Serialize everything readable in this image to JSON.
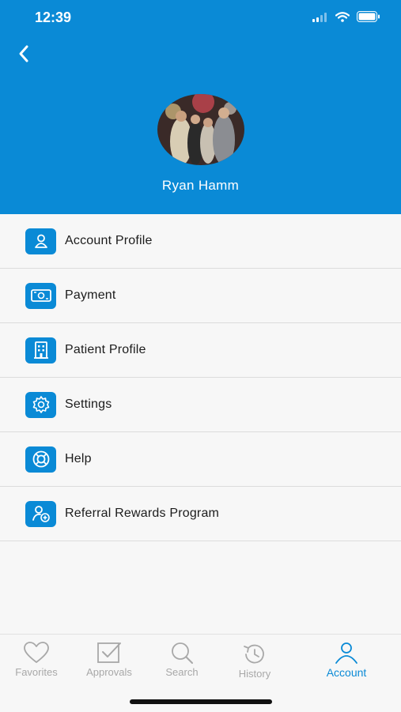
{
  "status_bar": {
    "time": "12:39"
  },
  "profile": {
    "name": "Ryan Hamm",
    "avatar_icon": "profile-photo"
  },
  "colors": {
    "brand": "#0a8ad6",
    "inactive": "#a8a8a8"
  },
  "menu": [
    {
      "label": "Account Profile",
      "icon": "person-icon"
    },
    {
      "label": "Payment",
      "icon": "cash-icon"
    },
    {
      "label": "Patient Profile",
      "icon": "building-icon"
    },
    {
      "label": "Settings",
      "icon": "gear-icon"
    },
    {
      "label": "Help",
      "icon": "lifebuoy-icon"
    },
    {
      "label": "Referral Rewards Program",
      "icon": "person-plus-icon"
    }
  ],
  "tabs": [
    {
      "label": "Favorites",
      "icon": "heart-icon",
      "active": false
    },
    {
      "label": "Approvals",
      "icon": "checkbox-icon",
      "active": false
    },
    {
      "label": "Search",
      "icon": "search-icon",
      "active": false
    },
    {
      "label": "History",
      "icon": "history-icon",
      "active": false
    },
    {
      "label": "Account",
      "icon": "person-icon",
      "active": true
    }
  ]
}
